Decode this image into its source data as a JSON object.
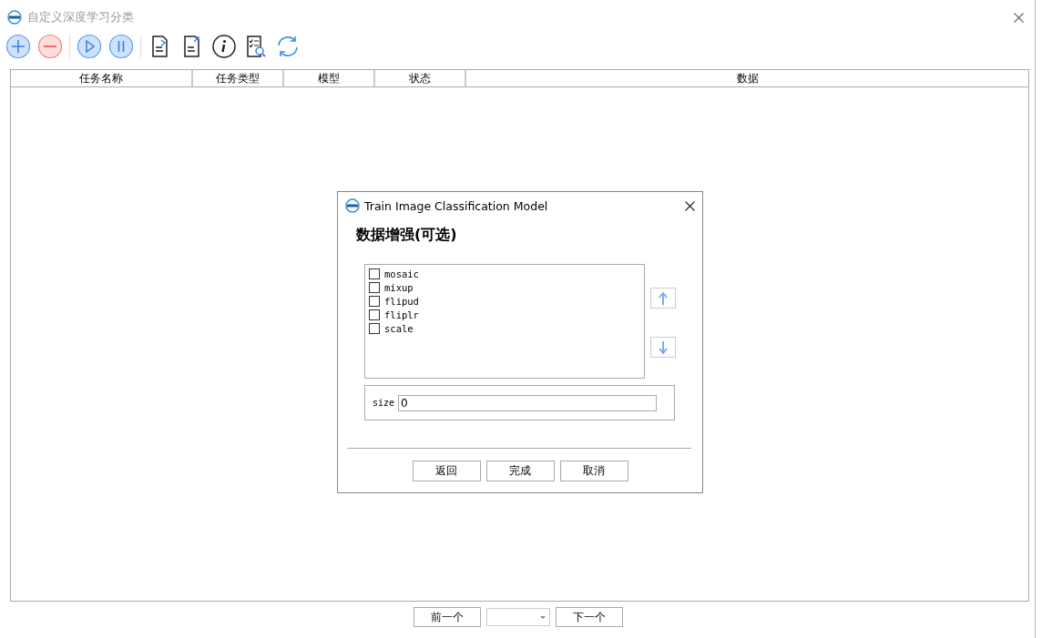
{
  "window": {
    "title": "自定义深度学习分类"
  },
  "table": {
    "columns": [
      "任务名称",
      "任务类型",
      "模型",
      "状态",
      "数据"
    ]
  },
  "dialog": {
    "title": "Train Image Classification Model",
    "heading": "数据增强(可选)",
    "options": [
      {
        "label": "mosaic",
        "checked": false
      },
      {
        "label": "mixup",
        "checked": false
      },
      {
        "label": "flipud",
        "checked": false
      },
      {
        "label": "fliplr",
        "checked": false
      },
      {
        "label": "scale",
        "checked": false
      }
    ],
    "size": {
      "label": "size",
      "value": "0"
    },
    "buttons": [
      "返回",
      "完成",
      "取消"
    ]
  },
  "pager": {
    "previous": "前一个",
    "next": "下一个"
  }
}
